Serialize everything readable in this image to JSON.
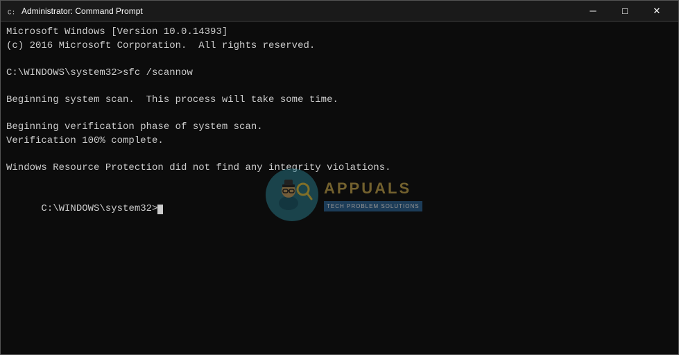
{
  "titleBar": {
    "icon": "cmd-icon",
    "title": "Administrator: Command Prompt",
    "minimizeLabel": "─",
    "maximizeLabel": "□",
    "closeLabel": "✕"
  },
  "terminal": {
    "lines": [
      "Microsoft Windows [Version 10.0.14393]",
      "(c) 2016 Microsoft Corporation.  All rights reserved.",
      "",
      "C:\\WINDOWS\\system32>sfc /scannow",
      "",
      "Beginning system scan.  This process will take some time.",
      "",
      "Beginning verification phase of system scan.",
      "Verification 100% complete.",
      "",
      "Windows Resource Protection did not find any integrity violations.",
      "",
      "C:\\WINDOWS\\system32>"
    ]
  },
  "watermark": {
    "name": "APPUALS",
    "tagline": "TECH PROBLEM SOLUTIONS"
  }
}
